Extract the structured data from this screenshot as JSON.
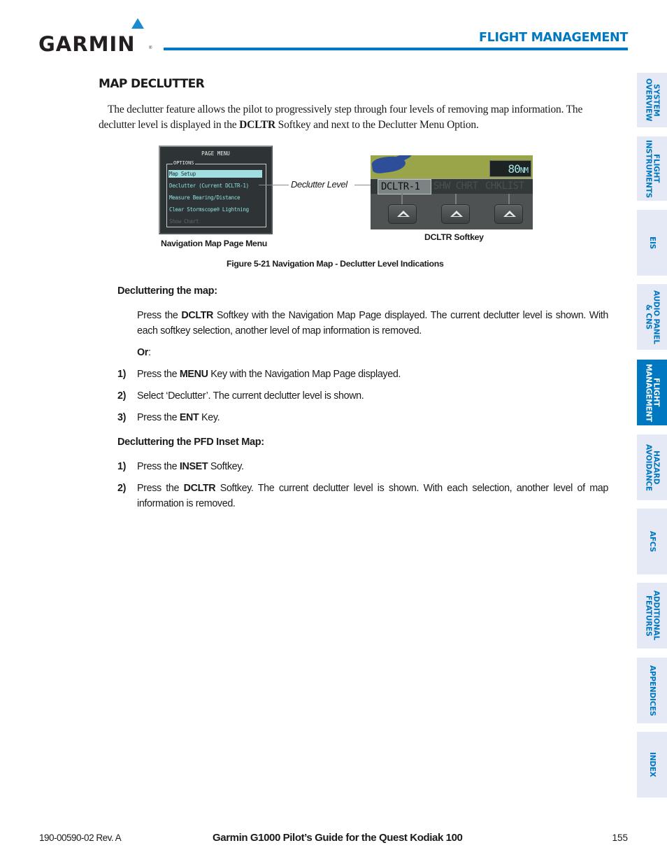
{
  "header": {
    "logo_text": "GARMIN",
    "logo_reg": "®",
    "section_title": "FLIGHT MANAGEMENT",
    "brand_color": "#0078c1"
  },
  "side_tabs": [
    {
      "label": "SYSTEM\nOVERVIEW",
      "active": false
    },
    {
      "label": "FLIGHT\nINSTRUMENTS",
      "active": false
    },
    {
      "label": "EIS",
      "active": false
    },
    {
      "label": "AUDIO PANEL\n& CNS",
      "active": false
    },
    {
      "label": "FLIGHT\nMANAGEMENT",
      "active": true
    },
    {
      "label": "HAZARD\nAVOIDANCE",
      "active": false
    },
    {
      "label": "AFCS",
      "active": false
    },
    {
      "label": "ADDITIONAL\nFEATURES",
      "active": false
    },
    {
      "label": "APPENDICES",
      "active": false
    },
    {
      "label": "INDEX",
      "active": false
    }
  ],
  "content": {
    "heading": "MAP DECLUTTER",
    "intro_part1": "The declutter feature allows the pilot to progressively step through four levels of removing map information. The declutter level is displayed in the ",
    "intro_bold": "DCLTR",
    "intro_part2": " Softkey and next to the Declutter Menu Option.",
    "figure": {
      "page_menu": {
        "title": "PAGE MENU",
        "legend": "OPTIONS",
        "items": [
          {
            "label": "Map Setup",
            "state": "selected"
          },
          {
            "label": "Declutter (Current DCLTR-1)",
            "state": "normal"
          },
          {
            "label": "Measure Bearing/Distance",
            "state": "normal"
          },
          {
            "label": "Clear Stormscope® Lightning",
            "state": "normal"
          },
          {
            "label": "Show Chart",
            "state": "disabled"
          }
        ],
        "caption": "Navigation Map Page Menu"
      },
      "callout": "Declutter Level",
      "softkeys": {
        "range_value": "80",
        "range_unit": "NM",
        "keys": [
          {
            "label": "DCLTR-1",
            "active": true
          },
          {
            "label": "SHW CHRT",
            "active": false
          },
          {
            "label": "CHKLIST",
            "active": false
          }
        ],
        "caption": "DCLTR Softkey"
      },
      "caption": "Figure 5-21  Navigation Map - Declutter Level Indications"
    },
    "section1": {
      "heading": "Decluttering the map:",
      "para_pre": "Press the ",
      "para_bold": "DCLTR",
      "para_post": " Softkey with the Navigation Map Page displayed.  The current declutter level is shown.  With each softkey selection, another level of map information is removed.",
      "or_label": "Or",
      "or_colon": ":",
      "steps": [
        {
          "num": "1)",
          "pre": "Press the ",
          "bold": "MENU",
          "post": " Key with the Navigation Map Page displayed."
        },
        {
          "num": "2)",
          "pre": "Select ‘Declutter’.  The current declutter level is shown.",
          "bold": "",
          "post": ""
        },
        {
          "num": "3)",
          "pre": "Press the ",
          "bold": "ENT",
          "post": " Key."
        }
      ]
    },
    "section2": {
      "heading": "Decluttering the PFD Inset Map:",
      "steps": [
        {
          "num": "1)",
          "pre": "Press the ",
          "bold": "INSET",
          "post": " Softkey."
        },
        {
          "num": "2)",
          "pre": "Press the ",
          "bold": "DCLTR",
          "post": " Softkey.  The current declutter level is shown.  With each selection, another level of map information is removed."
        }
      ]
    }
  },
  "footer": {
    "doc_number": "190-00590-02  Rev. A",
    "title": "Garmin G1000 Pilot’s Guide for the Quest Kodiak 100",
    "page_number": "155"
  }
}
